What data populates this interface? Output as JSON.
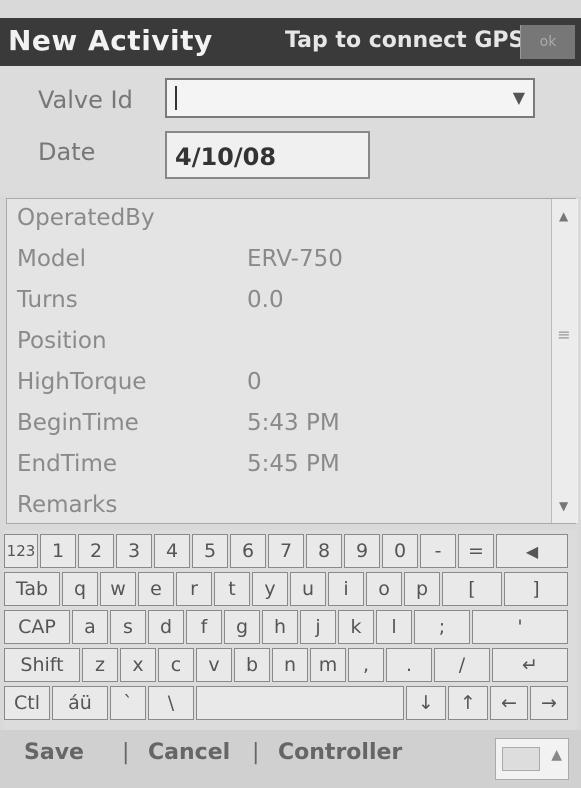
{
  "titlebar": {
    "title": "New Activity",
    "gps": "Tap to connect GPS",
    "ok": "ok"
  },
  "form": {
    "valve_label": "Valve Id",
    "valve_value": "",
    "date_label": "Date",
    "date_value": "4/10/08"
  },
  "grid": {
    "rows": [
      {
        "name": "OperatedBy",
        "value": ""
      },
      {
        "name": "Model",
        "value": "ERV-750"
      },
      {
        "name": "Turns",
        "value": "0.0"
      },
      {
        "name": "Position",
        "value": ""
      },
      {
        "name": "HighTorque",
        "value": "0"
      },
      {
        "name": "BeginTime",
        "value": "5:43 PM"
      },
      {
        "name": "EndTime",
        "value": "5:45 PM"
      },
      {
        "name": "Remarks",
        "value": ""
      }
    ]
  },
  "keyboard": {
    "row1": [
      "123",
      "1",
      "2",
      "3",
      "4",
      "5",
      "6",
      "7",
      "8",
      "9",
      "0",
      "-",
      "=",
      "◀"
    ],
    "row2": [
      "Tab",
      "q",
      "w",
      "e",
      "r",
      "t",
      "y",
      "u",
      "i",
      "o",
      "p",
      "[",
      "]"
    ],
    "row3": [
      "CAP",
      "a",
      "s",
      "d",
      "f",
      "g",
      "h",
      "j",
      "k",
      "l",
      ";",
      "'"
    ],
    "row4": [
      "Shift",
      "z",
      "x",
      "c",
      "v",
      "b",
      "n",
      "m",
      ",",
      ".",
      "/",
      "↵"
    ],
    "row5": [
      "Ctl",
      "áü",
      "`",
      "\\",
      "",
      "↓",
      "↑",
      "←",
      "→"
    ]
  },
  "menu": {
    "save": "Save",
    "cancel": "Cancel",
    "controller": "Controller",
    "sep": "|"
  }
}
